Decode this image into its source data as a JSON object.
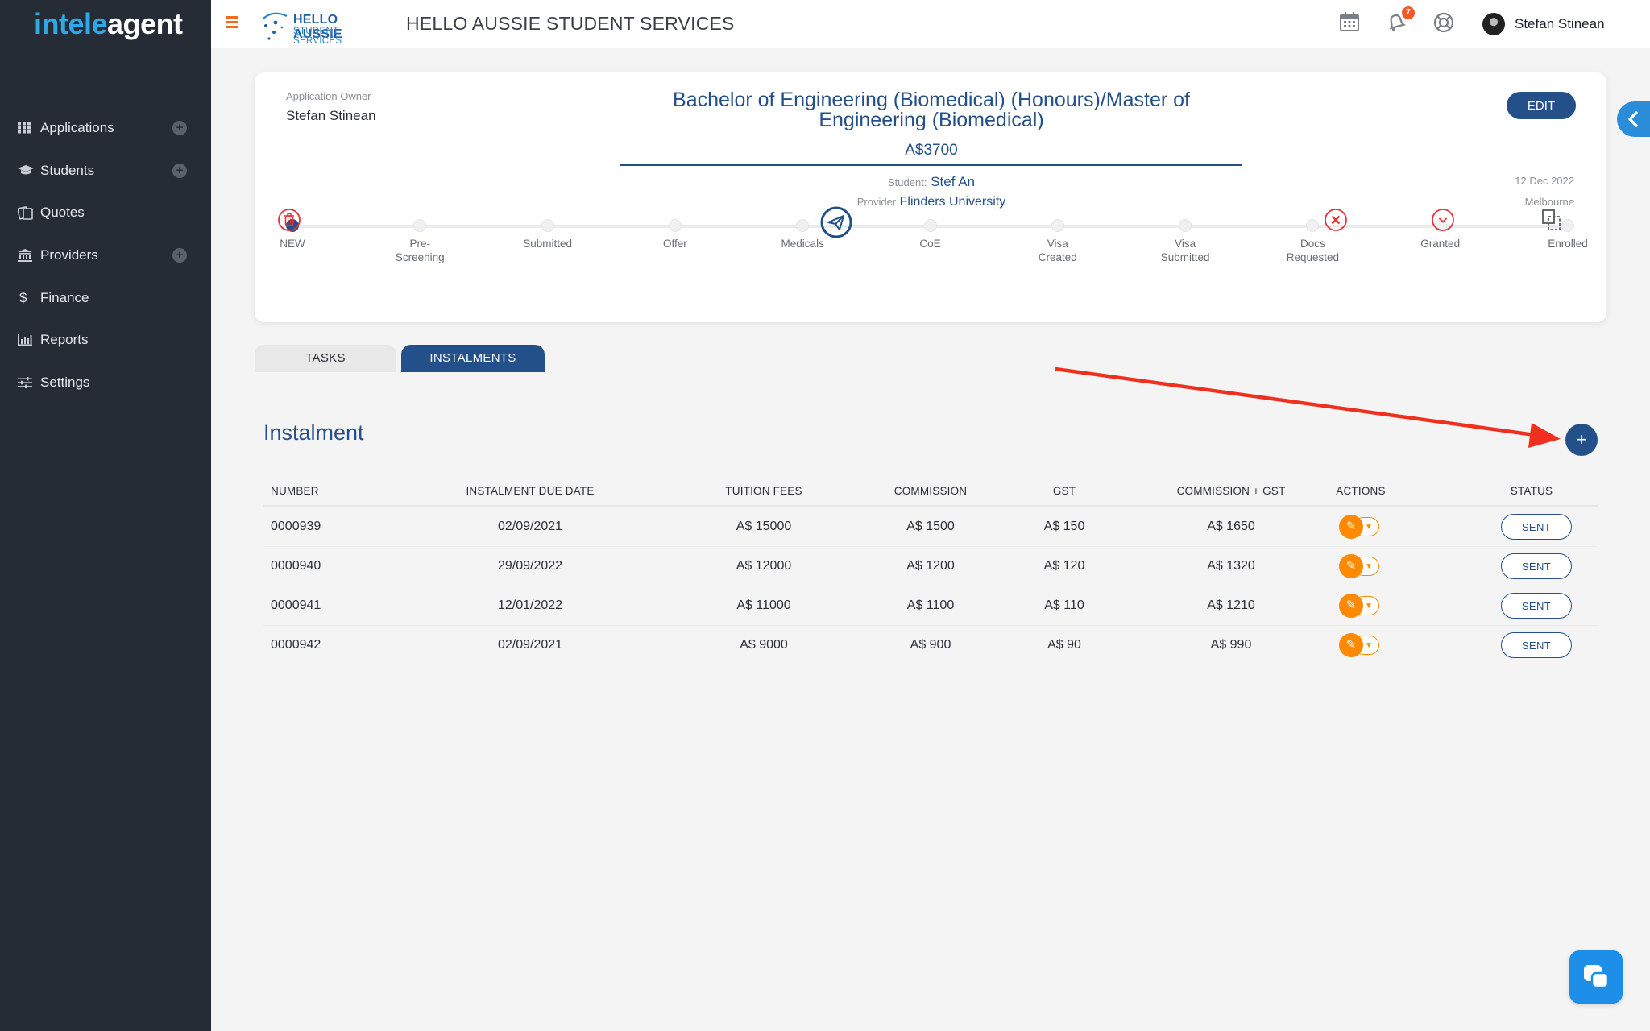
{
  "app": {
    "logo_part1": "intele",
    "logo_part2": "agent",
    "brand_line1": "HELLO AUSSIE",
    "brand_line2": "STUDENT SERVICES",
    "brand_name": "HELLO AUSSIE STUDENT SERVICES",
    "notifications_count": "7",
    "user_name": "Stefan Stinean"
  },
  "sidebar": {
    "items": [
      {
        "label": "Applications",
        "icon": "grid-icon",
        "has_add": true
      },
      {
        "label": "Students",
        "icon": "graduation-cap-icon",
        "has_add": true
      },
      {
        "label": "Quotes",
        "icon": "quotes-icon",
        "has_add": false
      },
      {
        "label": "Providers",
        "icon": "bank-icon",
        "has_add": true
      },
      {
        "label": "Finance",
        "icon": "dollar-icon",
        "has_add": false
      },
      {
        "label": "Reports",
        "icon": "bar-chart-icon",
        "has_add": false
      },
      {
        "label": "Settings",
        "icon": "sliders-icon",
        "has_add": false
      }
    ]
  },
  "application": {
    "owner_label": "Application Owner",
    "owner_name": "Stefan Stinean",
    "title_line1": "Bachelor of Engineering (Biomedical) (Honours)/Master of",
    "title_line2": "Engineering (Biomedical)",
    "price": "A$3700",
    "student_label": "Student:",
    "student_name": "Stef An",
    "provider_label": "Provider",
    "provider_name": "Flinders University",
    "date": "12 Dec 2022",
    "city": "Melbourne",
    "edit_label": "EDIT"
  },
  "progress": {
    "steps": [
      {
        "line1": "NEW",
        "line2": ""
      },
      {
        "line1": "Pre-",
        "line2": "Screening"
      },
      {
        "line1": "Submitted",
        "line2": ""
      },
      {
        "line1": "Offer",
        "line2": ""
      },
      {
        "line1": "Medicals",
        "line2": ""
      },
      {
        "line1": "CoE",
        "line2": ""
      },
      {
        "line1": "Visa",
        "line2": "Created"
      },
      {
        "line1": "Visa",
        "line2": "Submitted"
      },
      {
        "line1": "Docs",
        "line2": "Requested"
      },
      {
        "line1": "Granted",
        "line2": ""
      },
      {
        "line1": "Enrolled",
        "line2": ""
      }
    ],
    "active_index": 0
  },
  "tabs": {
    "tasks": "TASKS",
    "instalments": "INSTALMENTS"
  },
  "instalment": {
    "section_title": "Instalment",
    "add_label": "+",
    "headers": {
      "number": "NUMBER",
      "due_date": "INSTALMENT DUE DATE",
      "tuition": "TUITION FEES",
      "commission": "COMMISSION",
      "gst": "GST",
      "comm_gst": "COMMISSION + GST",
      "actions": "ACTIONS",
      "status": "STATUS"
    },
    "rows": [
      {
        "number": "0000939",
        "due_date": "02/09/2021",
        "tuition": "A$ 15000",
        "commission": "A$ 1500",
        "gst": "A$ 150",
        "comm_gst": "A$ 1650",
        "status": "SENT"
      },
      {
        "number": "0000940",
        "due_date": "29/09/2022",
        "tuition": "A$ 12000",
        "commission": "A$ 1200",
        "gst": "A$ 120",
        "comm_gst": "A$ 1320",
        "status": "SENT"
      },
      {
        "number": "0000941",
        "due_date": "12/01/2022",
        "tuition": "A$ 11000",
        "commission": "A$ 1100",
        "gst": "A$ 110",
        "comm_gst": "A$ 1210",
        "status": "SENT"
      },
      {
        "number": "0000942",
        "due_date": "02/09/2021",
        "tuition": "A$ 9000",
        "commission": "A$ 900",
        "gst": "A$ 90",
        "comm_gst": "A$ 990",
        "status": "SENT"
      }
    ]
  },
  "colors": {
    "primary": "#24508a",
    "accent_orange": "#ff8a00",
    "sidebar_bg": "#262c35",
    "annotation_red": "#f0301e"
  }
}
